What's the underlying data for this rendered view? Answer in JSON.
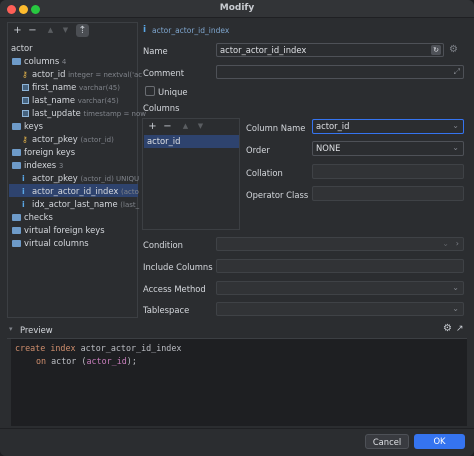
{
  "window": {
    "title": "Modify"
  },
  "toolbar": {
    "add": "+",
    "remove": "−",
    "up": "▲",
    "down": "▼",
    "filter": "⇡"
  },
  "tree": {
    "root": "actor",
    "columns_label": "columns",
    "columns_count": "4",
    "columns": [
      {
        "name": "actor_id",
        "type": "integer = nextval('ac"
      },
      {
        "name": "first_name",
        "type": "varchar(45)"
      },
      {
        "name": "last_name",
        "type": "varchar(45)"
      },
      {
        "name": "last_update",
        "type": "timestamp = now"
      }
    ],
    "keys_label": "keys",
    "keys": [
      {
        "name": "actor_pkey",
        "meta": "(actor_id)"
      }
    ],
    "foreign_keys_label": "foreign keys",
    "indexes_label": "indexes",
    "indexes_count": "3",
    "indexes": [
      {
        "name": "actor_pkey",
        "meta": "(actor_id) UNIQU"
      },
      {
        "name": "actor_actor_id_index",
        "meta": "(acto"
      },
      {
        "name": "idx_actor_last_name",
        "meta": "(last_"
      }
    ],
    "checks_label": "checks",
    "virtual_fk_label": "virtual foreign keys",
    "virtual_cols_label": "virtual columns"
  },
  "form": {
    "header_name": "actor_actor_id_index",
    "name_label": "Name",
    "name_value": "actor_actor_id_index",
    "comment_label": "Comment",
    "unique_label": "Unique",
    "columns_label": "Columns",
    "columns_rows": [
      "actor_id"
    ],
    "column_name_label": "Column Name",
    "column_name_value": "actor_id",
    "order_label": "Order",
    "order_value": "NONE",
    "collation_label": "Collation",
    "operator_class_label": "Operator Class",
    "condition_label": "Condition",
    "include_columns_label": "Include Columns",
    "access_method_label": "Access Method",
    "tablespace_label": "Tablespace"
  },
  "preview": {
    "label": "Preview",
    "line1_kw1": "create",
    "line1_kw2": "index",
    "line1_id": "actor_actor_id_index",
    "line2_kw": "on",
    "line2_tbl": "actor",
    "line2_open": "(",
    "line2_col": "actor_id",
    "line2_close": ");"
  },
  "footer": {
    "cancel": "Cancel",
    "ok": "OK"
  }
}
